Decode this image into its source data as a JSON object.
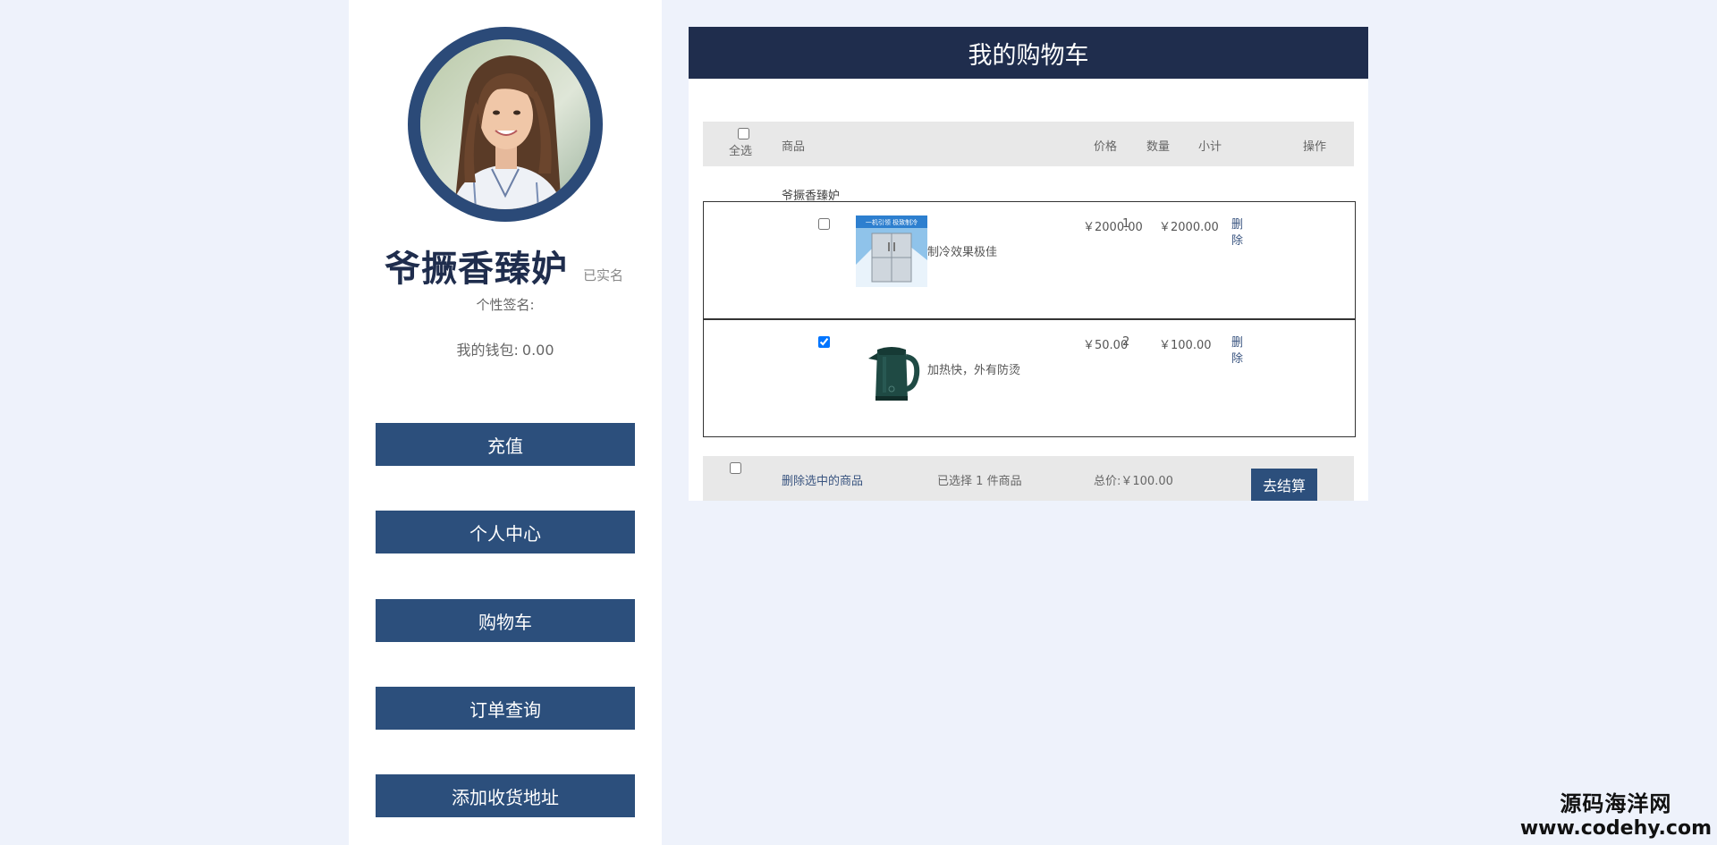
{
  "sidebar": {
    "username": "爷撅香臻妒",
    "verified_label": "已实名",
    "signature_label": "个性签名:",
    "wallet_label": "我的钱包:",
    "wallet_amount": "0.00",
    "buttons": [
      "充值",
      "个人中心",
      "购物车",
      "订单查询",
      "添加收货地址"
    ]
  },
  "cart": {
    "title": "我的购物车",
    "headers": {
      "select_all": "全选",
      "product": "商品",
      "price": "价格",
      "quantity": "数量",
      "subtotal": "小计",
      "action": "操作"
    },
    "shop_name": "爷撅香臻妒",
    "items": [
      {
        "checked": false,
        "description": "制冷效果极佳",
        "image_text": "一机引领 极致制冷",
        "price": "￥2000.00",
        "quantity": "1",
        "subtotal": "￥2000.00",
        "delete_label": "删除"
      },
      {
        "checked": true,
        "description": "加热快，外有防烫",
        "price": "￥50.00",
        "quantity": "2",
        "subtotal": "￥100.00",
        "delete_label": "删除"
      }
    ],
    "footer": {
      "delete_selected": "删除选中的商品",
      "selected_prefix": "已选择",
      "selected_count": "1",
      "selected_suffix": "件商品",
      "total_label": "总价:",
      "total_value": "￥100.00",
      "checkout_label": "去结算"
    }
  },
  "watermark": {
    "line1": "源码海洋网",
    "line2": "www.codehy.com"
  },
  "colors": {
    "page_bg": "#eef2fb",
    "header_bg": "#1f2d4d",
    "button_bg": "#2c4f7c",
    "avatar_ring": "#2b4a78"
  }
}
